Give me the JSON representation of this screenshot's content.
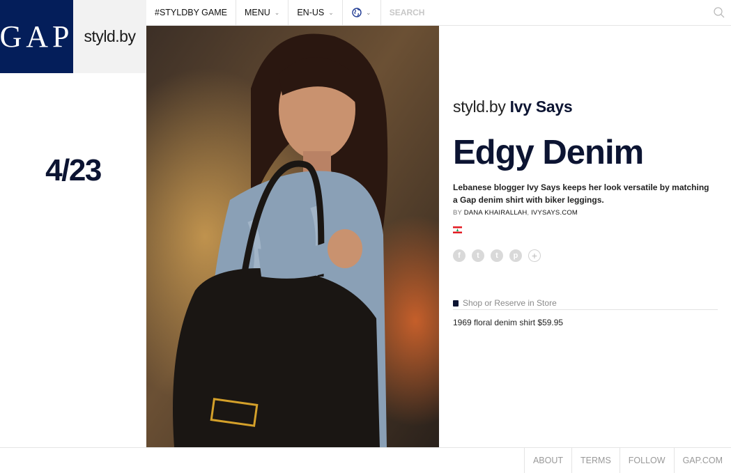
{
  "logo": {
    "text": "GAP"
  },
  "brand": {
    "text": "styld.by"
  },
  "nav": {
    "game": "#STYLDBY GAME",
    "menu": "MENU",
    "locale": "EN-US",
    "globe_icon": "globe-icon"
  },
  "search": {
    "placeholder": "SEARCH"
  },
  "date": "4/23",
  "article": {
    "stylist_prefix": "styld.by",
    "stylist_name": "Ivy Says",
    "headline": "Edgy Denim",
    "description": "Lebanese blogger Ivy Says keeps her look versatile by matching a Gap denim shirt with biker leggings.",
    "by_label": "BY",
    "author": "DANA KHAIRALLAH",
    "author_separator": ",",
    "site": "IVYSAYS.COM",
    "flag_icon": "lebanon-flag-icon",
    "social_icons": [
      "facebook-icon",
      "twitter-icon",
      "tumblr-icon",
      "pinterest-icon",
      "plus-icon"
    ],
    "social_glyphs": [
      "f",
      "t",
      "t",
      "p",
      "+"
    ]
  },
  "shop": {
    "label": "Shop or Reserve in Store"
  },
  "product": {
    "text": "1969 floral denim shirt $59.95"
  },
  "footer": {
    "links": [
      "ABOUT",
      "TERMS",
      "FOLLOW",
      "GAP.COM"
    ]
  },
  "colors": {
    "navy": "#041e5a",
    "heading": "#0c1432"
  }
}
